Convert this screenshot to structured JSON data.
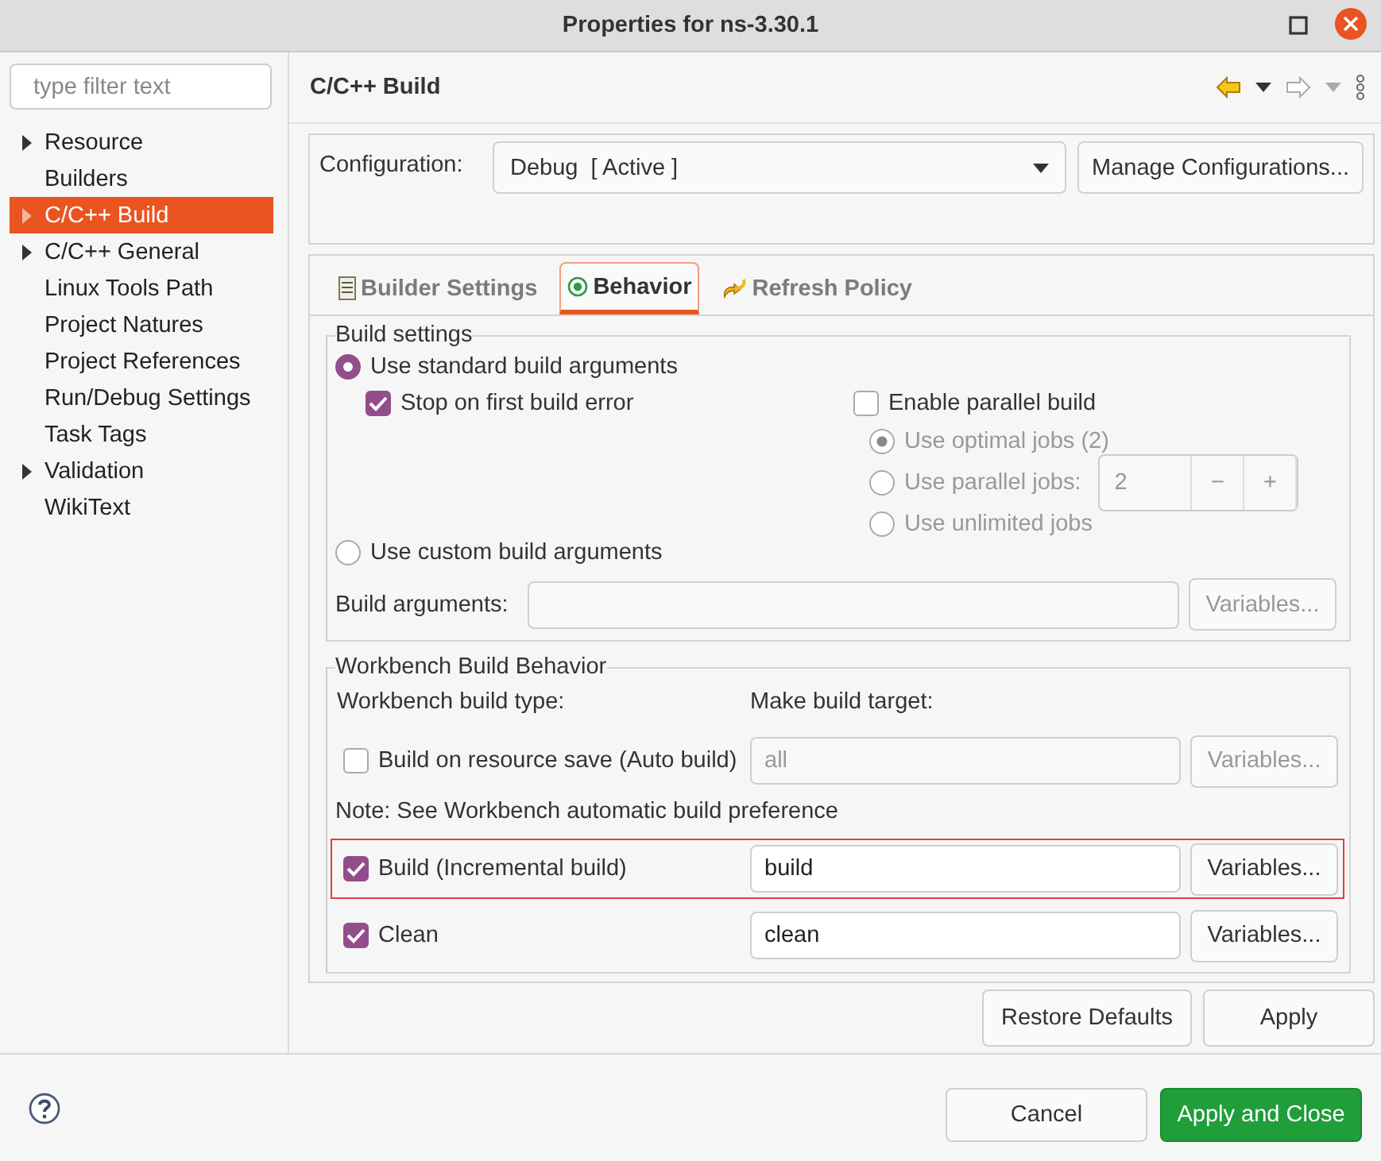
{
  "window": {
    "title": "Properties for ns-3.30.1"
  },
  "filter": {
    "placeholder": "type filter text"
  },
  "sidebar": {
    "items": [
      {
        "label": "Resource",
        "expandable": true,
        "selected": false
      },
      {
        "label": "Builders",
        "expandable": false,
        "selected": false
      },
      {
        "label": "C/C++ Build",
        "expandable": true,
        "selected": true
      },
      {
        "label": "C/C++ General",
        "expandable": true,
        "selected": false
      },
      {
        "label": "Linux Tools Path",
        "expandable": false,
        "selected": false
      },
      {
        "label": "Project Natures",
        "expandable": false,
        "selected": false
      },
      {
        "label": "Project References",
        "expandable": false,
        "selected": false
      },
      {
        "label": "Run/Debug Settings",
        "expandable": false,
        "selected": false
      },
      {
        "label": "Task Tags",
        "expandable": false,
        "selected": false
      },
      {
        "label": "Validation",
        "expandable": true,
        "selected": false
      },
      {
        "label": "WikiText",
        "expandable": false,
        "selected": false
      }
    ]
  },
  "page": {
    "title": "C/C++ Build"
  },
  "configuration": {
    "label": "Configuration:",
    "value": "Debug  [ Active ]",
    "button": "Manage Configurations..."
  },
  "tabs": [
    {
      "label": "Builder Settings",
      "selected": false
    },
    {
      "label": "Behavior",
      "selected": true
    },
    {
      "label": "Refresh Policy",
      "selected": false
    }
  ],
  "build_settings": {
    "title": "Build settings",
    "standard": {
      "label": "Use standard build arguments",
      "selected": true
    },
    "stop_on_error": {
      "label": "Stop on first build error",
      "checked": true
    },
    "parallel": {
      "label": "Enable parallel build",
      "checked": false
    },
    "jobs": [
      {
        "label": "Use optimal jobs (2)",
        "selected": true
      },
      {
        "label": "Use parallel jobs:",
        "selected": false
      },
      {
        "label": "Use unlimited jobs",
        "selected": false
      }
    ],
    "jobs_value": "2",
    "stepper": [
      "−",
      "+"
    ],
    "custom": {
      "label": "Use custom build arguments",
      "selected": false
    },
    "arguments": {
      "label": "Build arguments:",
      "button": "Variables..."
    }
  },
  "workbench": {
    "title": "Workbench Build Behavior",
    "type_label": "Workbench build type:",
    "target_label": "Make build target:",
    "note": "Note: See Workbench automatic build preference",
    "rows": [
      {
        "label": "Build on resource save (Auto build)",
        "checked": false,
        "value": "all",
        "button": "Variables...",
        "highlighted": false
      },
      {
        "label": "Build (Incremental build)",
        "checked": true,
        "value": "build",
        "button": "Variables...",
        "highlighted": true
      },
      {
        "label": "Clean",
        "checked": true,
        "value": "clean",
        "button": "Variables...",
        "highlighted": false
      }
    ]
  },
  "page_buttons": [
    "Restore Defaults",
    "Apply"
  ],
  "dialog_buttons": [
    {
      "label": "Cancel",
      "primary": false
    },
    {
      "label": "Apply and Close",
      "primary": true
    }
  ]
}
